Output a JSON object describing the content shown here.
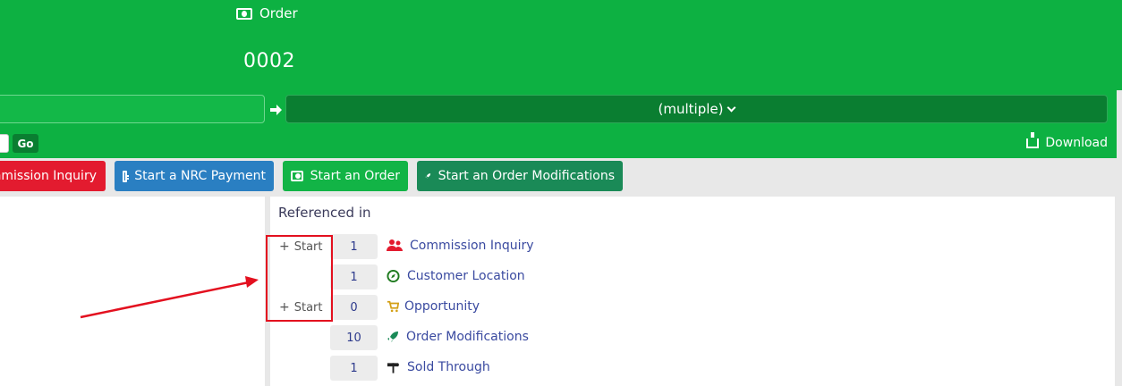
{
  "header": {
    "entity_type": "Order",
    "record_id": "0002"
  },
  "filter": {
    "selected_value": "(multiple)"
  },
  "toolbar": {
    "go_label": "Go",
    "download_label": "Download"
  },
  "actions": [
    {
      "label": "Commission Inquiry",
      "visible_label": "mmission Inquiry",
      "color": "#e31b2f"
    },
    {
      "label": "Start a NRC Payment",
      "color": "#2a7fc2"
    },
    {
      "label": "Start an Order",
      "color": "#12b446"
    },
    {
      "label": "Start an Order Modifications",
      "color": "#1a8a57"
    }
  ],
  "referenced_in": {
    "title": "Referenced in",
    "start_label": "Start",
    "items": [
      {
        "count": "1",
        "label": "Commission Inquiry",
        "icon": "users-icon",
        "icon_color": "#e31b2f",
        "has_start": true
      },
      {
        "count": "1",
        "label": "Customer Location",
        "icon": "compass-icon",
        "icon_color": "#1e7a1e",
        "has_start": false
      },
      {
        "count": "0",
        "label": "Opportunity",
        "icon": "cart-icon",
        "icon_color": "#d4a017",
        "has_start": true
      },
      {
        "count": "10",
        "label": "Order Modifications",
        "icon": "rocket-icon",
        "icon_color": "#1a8a57",
        "has_start": false
      },
      {
        "count": "1",
        "label": "Sold Through",
        "icon": "signpost-icon",
        "icon_color": "#222222",
        "has_start": false
      }
    ]
  },
  "colors": {
    "header_green": "#0db142",
    "dark_green": "#0a7e31",
    "annotation_red": "#e3101f"
  }
}
